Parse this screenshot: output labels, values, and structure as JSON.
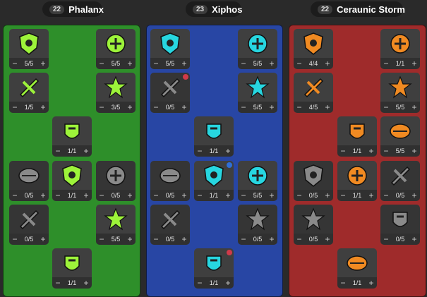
{
  "colors": {
    "phalanx_bg": "#2e8f2a",
    "xiphos_bg": "#2846a4",
    "storm_bg": "#9f2b2b",
    "phalanx_icon": "#9df33a",
    "xiphos_icon": "#27d6e0",
    "storm_icon": "#f08a22"
  },
  "trees": [
    {
      "id": "phalanx",
      "points": "22",
      "name": "Phalanx",
      "nodes": [
        {
          "rank": "5/5",
          "icon": "shield-emblem-icon",
          "active": true
        },
        {
          "rank": "5/5",
          "icon": "kangaroo-shield-icon",
          "active": true
        },
        {
          "rank": "1/5",
          "icon": "burst-orb-icon",
          "active": true
        },
        {
          "rank": "3/5",
          "icon": "spartan-helm-icon",
          "active": true
        },
        {
          "rank": "1/1",
          "icon": "horn-icon",
          "active": true
        },
        {
          "rank": "0/5",
          "icon": "round-shield-icon",
          "active": false
        },
        {
          "rank": "1/1",
          "icon": "winged-emblem-icon",
          "active": true
        },
        {
          "rank": "0/5",
          "icon": "cross-shield-icon",
          "active": false
        },
        {
          "rank": "0/5",
          "icon": "crossed-spears-icon",
          "active": false
        },
        {
          "rank": "5/5",
          "icon": "armored-warrior-icon",
          "active": true
        },
        {
          "rank": "1/1",
          "icon": "war-horn-icon",
          "active": true
        }
      ]
    },
    {
      "id": "xiphos",
      "points": "23",
      "name": "Xiphos",
      "nodes": [
        {
          "rank": "5/5",
          "icon": "sword-fist-icon",
          "active": true
        },
        {
          "rank": "5/5",
          "icon": "cross-gauntlet-icon",
          "active": true
        },
        {
          "rank": "0/5",
          "icon": "winged-blade-icon",
          "active": false,
          "badge": "red"
        },
        {
          "rank": "5/5",
          "icon": "skull-burst-icon",
          "active": true
        },
        {
          "rank": "1/1",
          "icon": "sword-strike-icon",
          "active": true
        },
        {
          "rank": "0/5",
          "icon": "splatter-icon",
          "active": false
        },
        {
          "rank": "1/1",
          "icon": "whirl-sword-icon",
          "active": true,
          "badge": "blue"
        },
        {
          "rank": "5/5",
          "icon": "slash-icon",
          "active": true
        },
        {
          "rank": "0/5",
          "icon": "helm-blade-icon",
          "active": false
        },
        {
          "rank": "0/5",
          "icon": "dagger-thrust-icon",
          "active": false
        },
        {
          "rank": "1/1",
          "icon": "skull-crossed-swords-icon",
          "active": true,
          "badge": "red"
        }
      ]
    },
    {
      "id": "ceraunic-storm",
      "points": "22",
      "name": "Ceraunic Storm",
      "nodes": [
        {
          "rank": "4/4",
          "icon": "lightning-scroll-icon",
          "active": true
        },
        {
          "rank": "1/1",
          "icon": "storm-skull-icon",
          "active": true
        },
        {
          "rank": "4/5",
          "icon": "lightning-arrow-icon",
          "active": true
        },
        {
          "rank": "5/5",
          "icon": "storm-shield-icon",
          "active": true
        },
        {
          "rank": "1/1",
          "icon": "lightning-bird-icon",
          "active": true
        },
        {
          "rank": "5/5",
          "icon": "spark-star-icon",
          "active": true
        },
        {
          "rank": "0/5",
          "icon": "storm-cloud-icon",
          "active": false
        },
        {
          "rank": "1/1",
          "icon": "thunder-ring-icon",
          "active": true
        },
        {
          "rank": "0/5",
          "icon": "shock-bolts-icon",
          "active": false
        },
        {
          "rank": "0/5",
          "icon": "storm-beast-icon",
          "active": false
        },
        {
          "rank": "0/5",
          "icon": "chain-lightning-icon",
          "active": false
        },
        {
          "rank": "1/1",
          "icon": "thunderstrike-icon",
          "active": true
        }
      ]
    }
  ],
  "controls": {
    "minus": "−",
    "plus": "+"
  }
}
